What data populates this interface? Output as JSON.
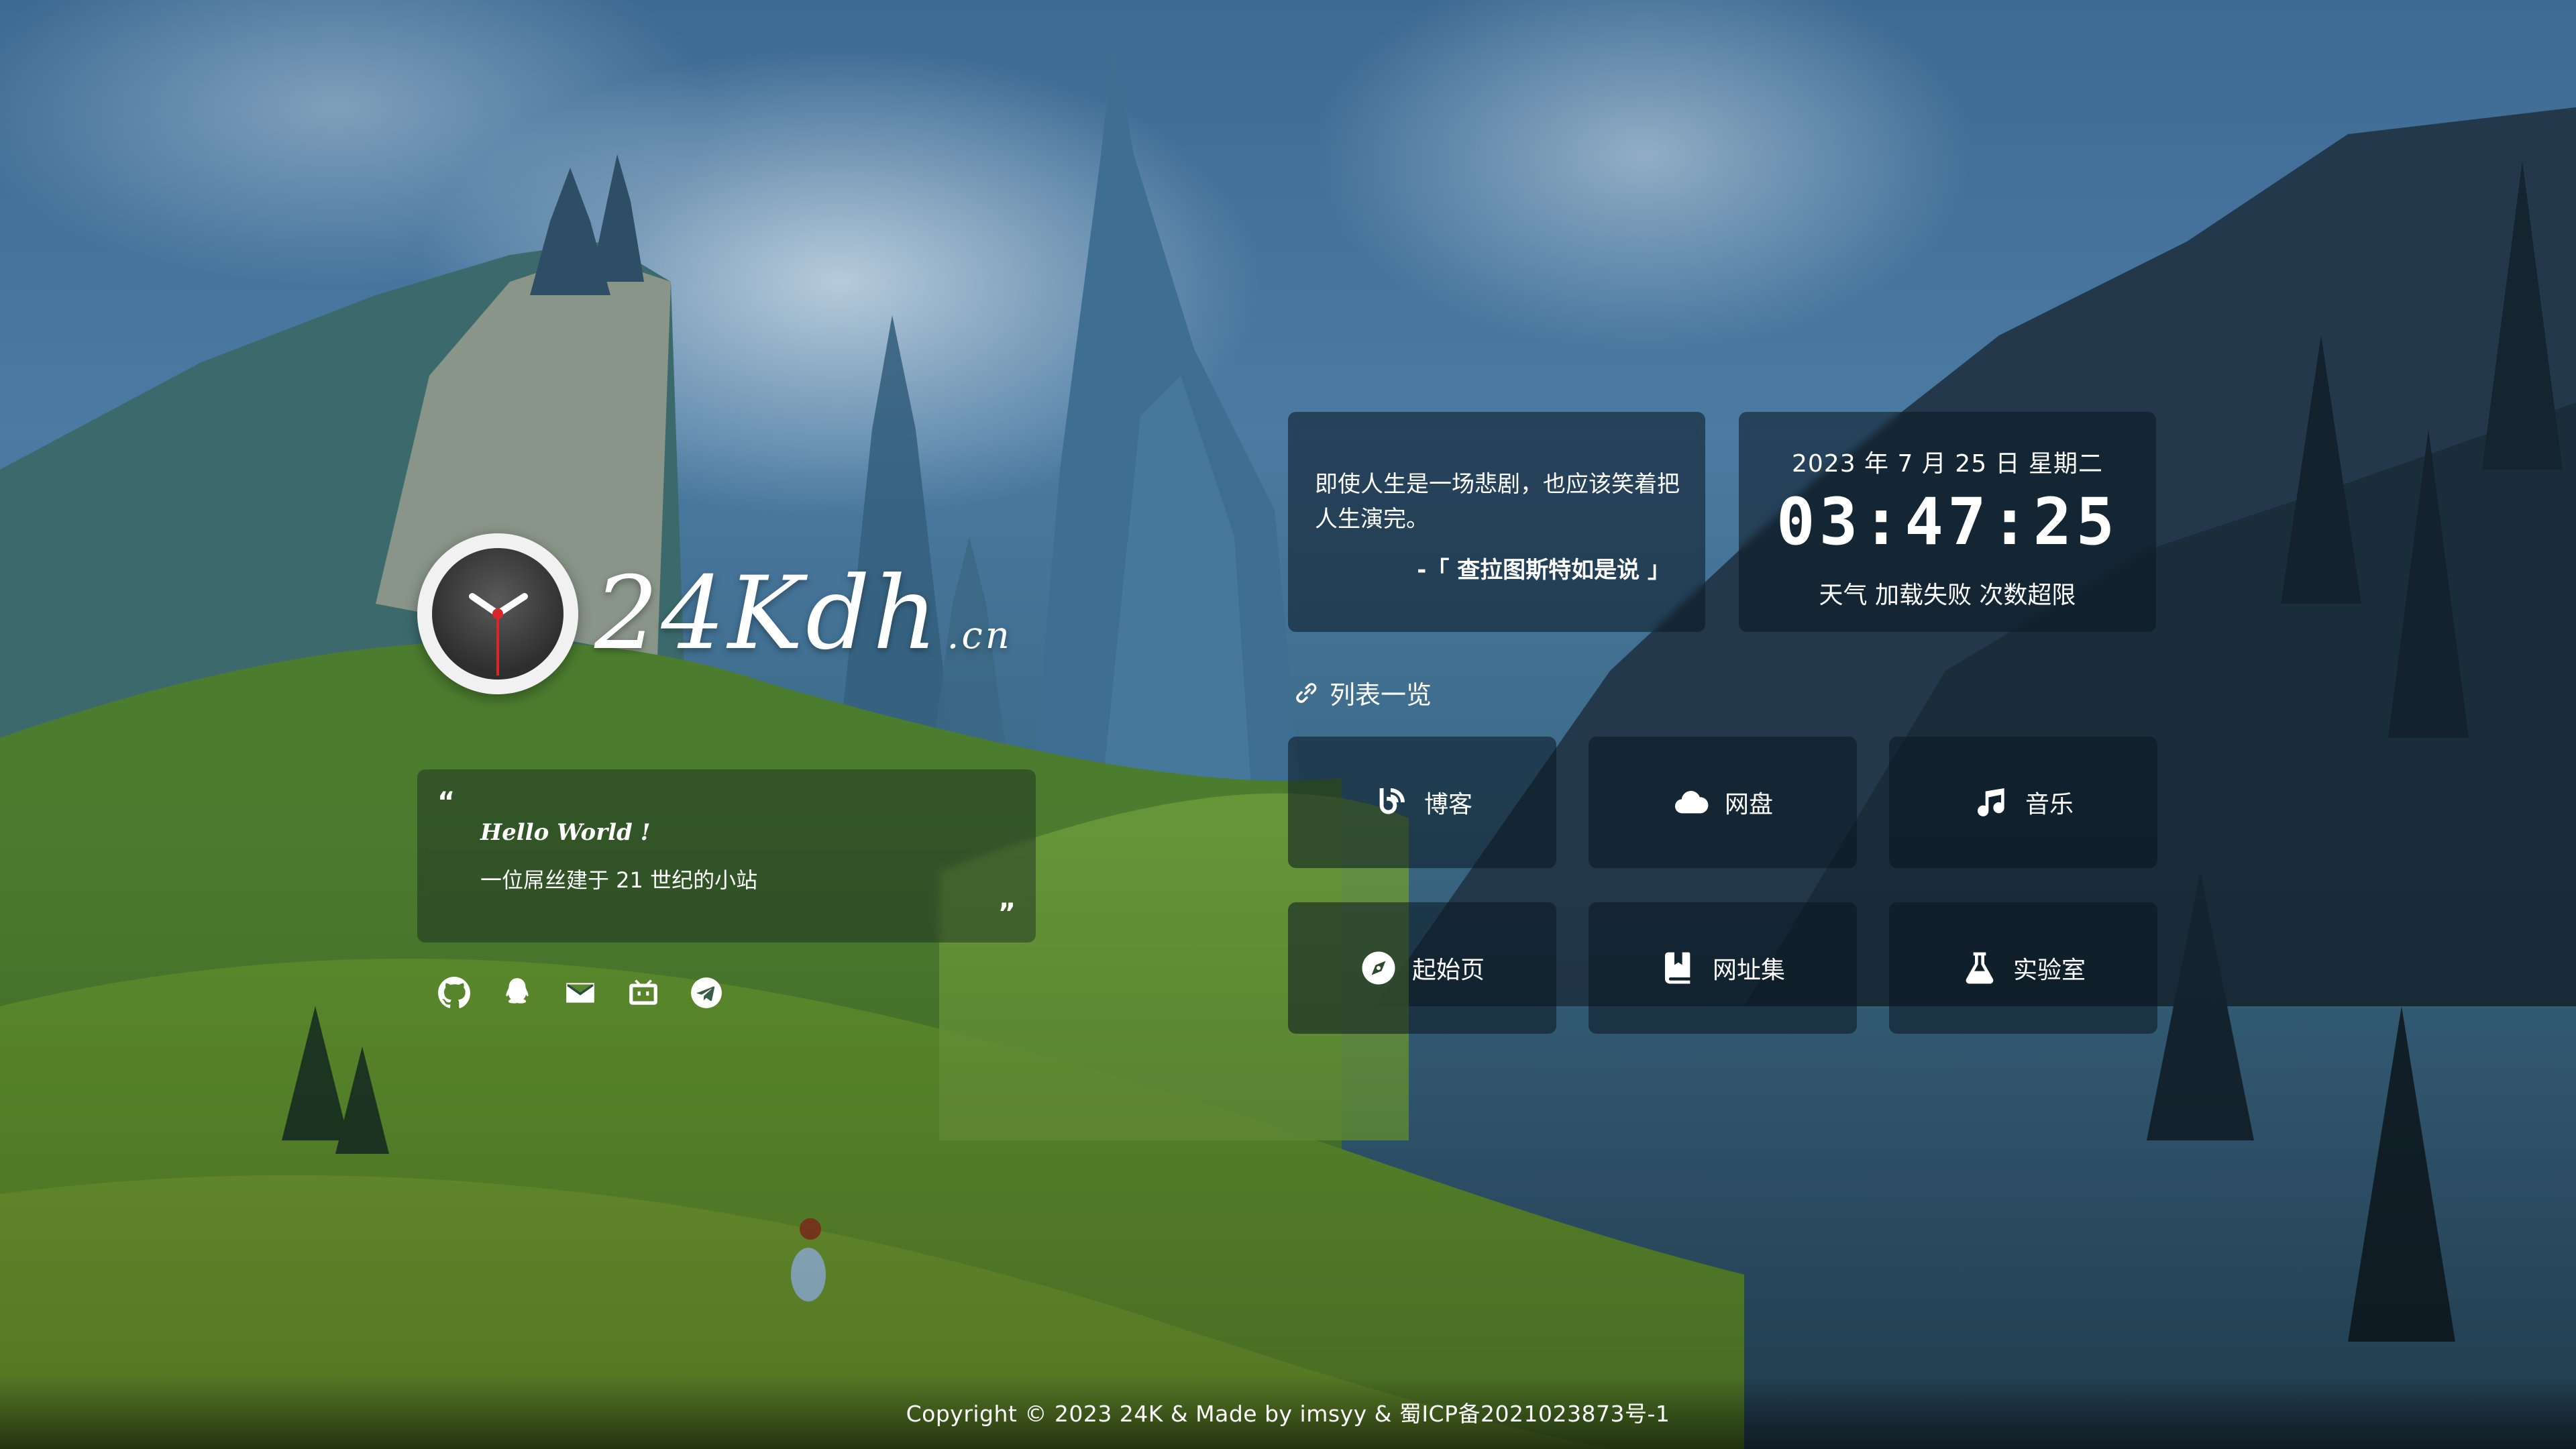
{
  "logo": {
    "name": "24Kdh",
    "tld": ".cn",
    "icon": "clock-icon"
  },
  "hello": {
    "title": "Hello World !",
    "subtitle": "一位屌丝建于 21 世纪的小站",
    "quote_open": "“",
    "quote_close": "”"
  },
  "social": [
    {
      "name": "github-icon"
    },
    {
      "name": "qq-icon"
    },
    {
      "name": "email-icon"
    },
    {
      "name": "bilibili-icon"
    },
    {
      "name": "telegram-icon"
    }
  ],
  "quote": {
    "text": "即使人生是一场悲剧，也应该笑着把人生演完。",
    "source": "-「 查拉图斯特如是说 」"
  },
  "time": {
    "date": "2023 年 7 月 25 日 星期二",
    "clock": "03:47:25",
    "weather": "天气 加载失败 次数超限"
  },
  "list": {
    "title": "列表一览",
    "items": [
      {
        "label": "博客",
        "icon": "blog-icon"
      },
      {
        "label": "网盘",
        "icon": "cloud-icon"
      },
      {
        "label": "音乐",
        "icon": "music-icon"
      },
      {
        "label": "起始页",
        "icon": "compass-icon"
      },
      {
        "label": "网址集",
        "icon": "bookmark-icon"
      },
      {
        "label": "实验室",
        "icon": "flask-icon"
      }
    ]
  },
  "footer": {
    "text": "Copyright © 2023 24K & Made by imsyy & 蜀ICP备2021023873号-1"
  }
}
